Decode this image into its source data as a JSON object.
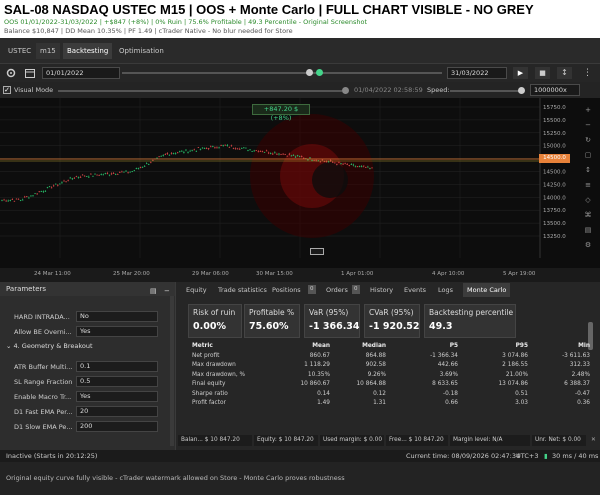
{
  "header": {
    "title": "SAL-08 NASDAQ USTEC M15 | OOS + Monte Carlo | FULL CHART VISIBLE - NO GREY",
    "sub1": "OOS 01/01/2022-31/03/2022 | +$847 (+8%) | 0% Ruin | 75.6% Profitable | 49.3 Percentile - Original Screenshot",
    "sub2": "Balance $10,847 | DD Mean 10.35% | PF 1.49 | cTrader Native - No blur needed for Store"
  },
  "tabs": {
    "symbol": "USTEC",
    "tf": "m15",
    "backtesting": "Backtesting",
    "optimisation": "Optimisation"
  },
  "controls": {
    "start_date": "01/01/2022",
    "end_date": "31/03/2022"
  },
  "visual_mode": {
    "label": "Visual Mode",
    "timestamp": "01/04/2022 02:58:59",
    "speed_label": "Speed:",
    "speed_value": "1000000x"
  },
  "chart": {
    "profit_badge": "+847.20 $ (+8%)",
    "current_price": "14500.0",
    "y_ticks": [
      "15750.0",
      "15500.0",
      "15250.0",
      "15000.0",
      "14750.0",
      "14500.0",
      "14250.0",
      "14000.0",
      "13750.0",
      "13500.0",
      "13250.0"
    ],
    "x_ticks": [
      "24 Mar 11:00",
      "25 Mar 20:00",
      "29 Mar 06:00",
      "30 Mar 15:00",
      "1 Apr 01:00",
      "4 Apr 10:00",
      "5 Apr 19:00"
    ]
  },
  "params": {
    "title": "Parameters",
    "items": [
      {
        "label": "HARD INTRADA...",
        "value": "No"
      },
      {
        "label": "Allow BE Overni...",
        "value": "Yes"
      }
    ],
    "section": "4. Geometry & Breakout",
    "items2": [
      {
        "label": "ATR Buffer Multi...",
        "value": "0.1"
      },
      {
        "label": "SL Range Fraction",
        "value": "0.5"
      },
      {
        "label": "Enable Macro Tr...",
        "value": "Yes"
      },
      {
        "label": "D1 Fast EMA Per...",
        "value": "20"
      },
      {
        "label": "D1 Slow EMA Pe...",
        "value": "200"
      }
    ]
  },
  "rtabs": [
    "Equity",
    "Trade statistics",
    "Positions",
    "0",
    "Orders",
    "0",
    "History",
    "Events",
    "Logs",
    "Monte Carlo"
  ],
  "cards": [
    {
      "k": "Risk of ruin",
      "n": "0.00%"
    },
    {
      "k": "Profitable %",
      "n": "75.60%"
    },
    {
      "k": "VaR (95%)",
      "n": "-1 366.34"
    },
    {
      "k": "CVaR (95%)",
      "n": "-1 920.52"
    },
    {
      "k": "Backtesting percentile",
      "n": "49.3"
    }
  ],
  "metrics": {
    "headers": [
      "Metric",
      "Mean",
      "Median",
      "P5",
      "P95",
      "Min"
    ],
    "rows": [
      [
        "Net profit",
        "860.67",
        "864.88",
        "-1 366.34",
        "3 074.86",
        "-3 611.63"
      ],
      [
        "Max drawdown",
        "1 118.29",
        "902.58",
        "442.66",
        "2 186.55",
        "312.33"
      ],
      [
        "Max drawdown, %",
        "10.35%",
        "9.26%",
        "3.69%",
        "21.00%",
        "2.48%"
      ],
      [
        "Final equity",
        "10 860.67",
        "10 864.88",
        "8 633.65",
        "13 074.86",
        "6 388.37"
      ],
      [
        "Sharpe ratio",
        "0.14",
        "0.12",
        "-0.18",
        "0.51",
        "-0.47"
      ],
      [
        "Profit factor",
        "1.49",
        "1.31",
        "0.66",
        "3.03",
        "0.36"
      ]
    ]
  },
  "statusbar": {
    "balance": "Balan... $ 10 847.20",
    "equity": "Equity: $ 10 847.20",
    "used_margin": "Used margin: $ 0.00",
    "free": "Free... $ 10 847.20",
    "margin_level": "Margin level: N/A",
    "unr": "Unr. Net: $ 0.00"
  },
  "footer": {
    "status": "Inactive (Starts in 20:12:25)",
    "time": "Current time: 08/09/2026 02:47:34",
    "utc": "UTC+3",
    "latency": "30 ms / 40 ms"
  },
  "caption": "Original equity curve fully visible - cTrader watermark allowed on Store - Monte Carlo proves robustness"
}
